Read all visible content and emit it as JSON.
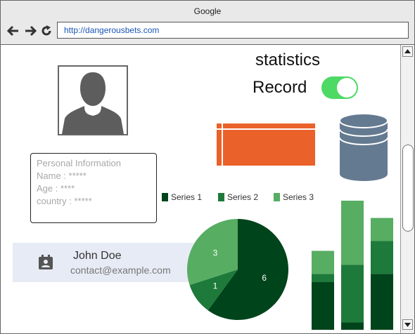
{
  "browser": {
    "window_title": "Google",
    "url": "http://dangerousbets.com"
  },
  "icons": {
    "back": "arrow-left-icon",
    "forward": "arrow-right-icon",
    "reload": "reload-icon",
    "avatar": "user-silhouette-icon",
    "table": "table-icon",
    "database": "database-icon",
    "contact": "contact-card-icon"
  },
  "page": {
    "title": "statistics",
    "record_label": "Record",
    "record_on": true
  },
  "personal_info": {
    "heading": "Personal Information",
    "name_line": "Name : *****",
    "age_line": "Age : ****",
    "country_line": "country : *****"
  },
  "contact": {
    "name": "John Doe",
    "email": "contact@example.com"
  },
  "colors": {
    "series1": "#00441b",
    "series2": "#1d7a3a",
    "series3": "#57ad62",
    "accent_orange": "#ea6129",
    "toggle_on": "#4cd964",
    "db": "#647a90"
  },
  "chart_data": [
    {
      "type": "pie",
      "series": [
        {
          "name": "Series 1",
          "value": 6
        },
        {
          "name": "Series 2",
          "value": 1
        },
        {
          "name": "Series 3",
          "value": 3
        }
      ],
      "labels": [
        "6",
        "1",
        "3"
      ]
    },
    {
      "type": "bar",
      "stacked": true,
      "categories": [
        "",
        "",
        ""
      ],
      "series": [
        {
          "name": "Series 1",
          "values": [
            58,
            9,
            68
          ]
        },
        {
          "name": "Series 2",
          "values": [
            10,
            70,
            40
          ]
        },
        {
          "name": "Series 3",
          "values": [
            28,
            78,
            28
          ]
        }
      ]
    }
  ]
}
